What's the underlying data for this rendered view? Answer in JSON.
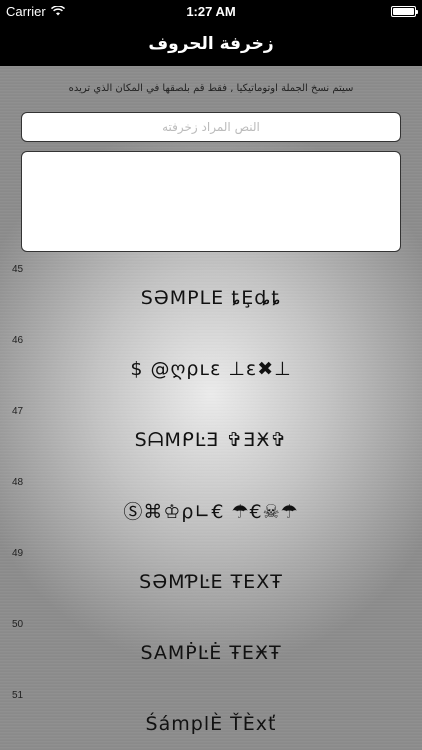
{
  "status_bar": {
    "carrier": "Carrier",
    "time": "1:27 AM",
    "battery_level": 1.0
  },
  "nav": {
    "title": "زخرفة الحروف"
  },
  "hint": "سيتم نسخ الجملة اوتوماتيكيا , فقط قم بلصقها في المكان الذي تريده",
  "input": {
    "placeholder": "النص المراد زخرفته",
    "value": ""
  },
  "output": {
    "value": ""
  },
  "styles": [
    {
      "number": "45",
      "text": "SƏMPLE ȶȨȡȶ"
    },
    {
      "number": "46",
      "text": "$ @ღρʟɛ ⊥ɛ✖⊥"
    },
    {
      "number": "47",
      "text": "SᗩMᑭĿƎ ✞ƎӾ✞"
    },
    {
      "number": "48",
      "text": "Ⓢ⌘♔ρ∟€ ☂€☠☂"
    },
    {
      "number": "49",
      "text": "SƏMƤĿE ŦEXŦ"
    },
    {
      "number": "50",
      "text": "SAMṖĿĖ ŦEӾŦ"
    },
    {
      "number": "51",
      "text": "ŚámplÈ ŤÈxť"
    }
  ]
}
